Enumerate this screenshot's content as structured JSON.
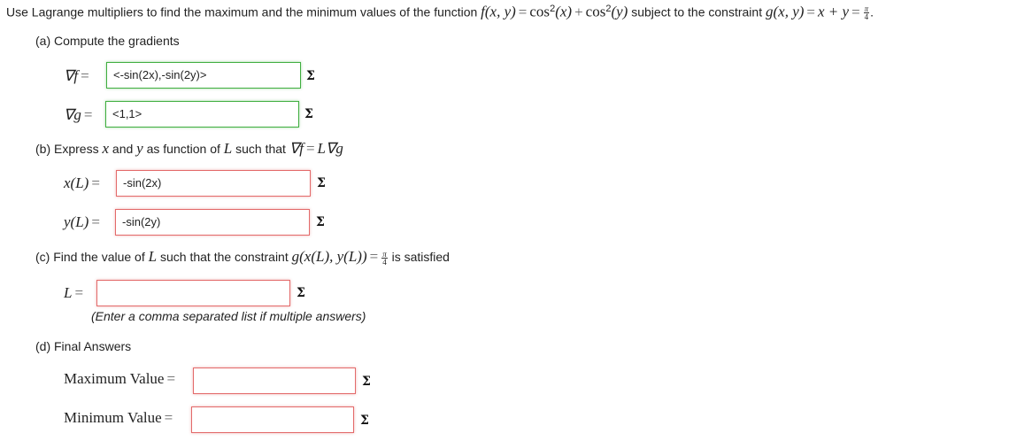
{
  "problem": {
    "intro": "Use Lagrange multipliers to find the maximum and the minimum values of the function",
    "func_lhs": "f(x, y)",
    "func_rhs_a": "cos",
    "func_arg_a": "(x)",
    "plus": "+",
    "func_rhs_b": "cos",
    "func_arg_b": "(y)",
    "sq": "2",
    "subject_to": "subject to the constraint",
    "constraint_lhs": "g(x, y)",
    "constraint_rhs": "x + y",
    "pi": "π",
    "four": "4",
    "period": "."
  },
  "part_a": {
    "title": "(a) Compute the gradients",
    "grad_f_label": "∇f",
    "grad_f_value": "<-sin(2x),-sin(2y)>",
    "grad_g_label": "∇g",
    "grad_g_value": "<1,1>"
  },
  "part_b": {
    "title_prefix": "(b) Express",
    "x_var": "x",
    "and": "and",
    "y_var": "y",
    "title_mid": "as function of",
    "L_var": "L",
    "title_suffix": "such that",
    "eq_lhs": "∇f",
    "eq_rhs": "L∇g",
    "x_label": "x(L)",
    "x_value": "-sin(2x)",
    "y_label": "y(L)",
    "y_value": "-sin(2y)"
  },
  "part_c": {
    "title_prefix": "(c) Find the value of",
    "L_var": "L",
    "title_mid": "such that the constraint",
    "constraint": "g(x(L), y(L))",
    "title_suffix": "is satisfied",
    "L_label": "L",
    "L_value": "",
    "hint": "(Enter a comma separated list if multiple answers)"
  },
  "part_d": {
    "title": "(d) Final Answers",
    "max_label": "Maximum Value",
    "max_value": "",
    "min_label": "Minimum Value",
    "min_value": ""
  },
  "icons": {
    "sigma": "Σ",
    "equals": "="
  },
  "colors": {
    "correct_border": "#3fae3f",
    "incorrect_border": "#e36a6a"
  }
}
